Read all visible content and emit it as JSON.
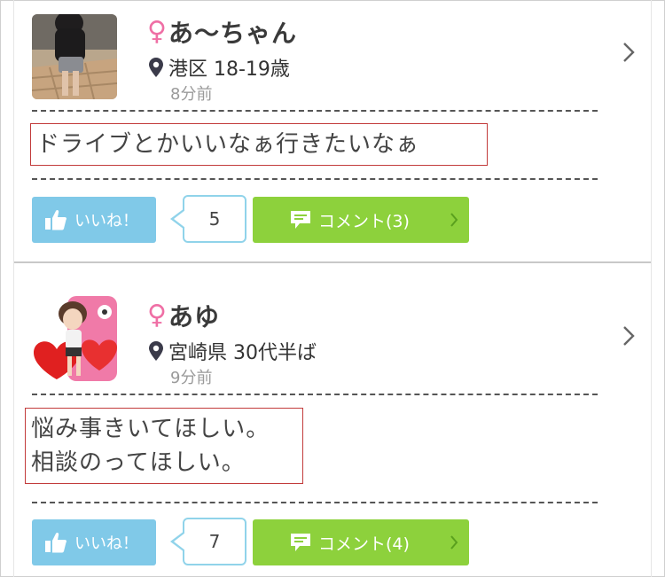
{
  "posts": [
    {
      "name": "あ〜ちゃん",
      "gender_icon": "female-icon",
      "gender_symbol": "♀",
      "location": "港区 18-19歳",
      "time": "8分前",
      "message_lines": [
        "ドライブとかいいなぁ行きたいなぁ"
      ],
      "like_label": "いいね！",
      "like_count": "5",
      "comment_label": "コメント(3)"
    },
    {
      "name": "あゆ",
      "gender_icon": "female-icon",
      "gender_symbol": "♀",
      "location": "宮崎県 30代半ば",
      "time": "9分前",
      "message_lines": [
        "悩み事きいてほしい。",
        "相談のってほしい。"
      ],
      "like_label": "いいね！",
      "like_count": "7",
      "comment_label": "コメント(4)"
    }
  ],
  "colors": {
    "female": "#ef6fa5",
    "like_button": "#80c9e8",
    "comment_button": "#8dd13c",
    "highlight_border": "#c23b3b"
  }
}
